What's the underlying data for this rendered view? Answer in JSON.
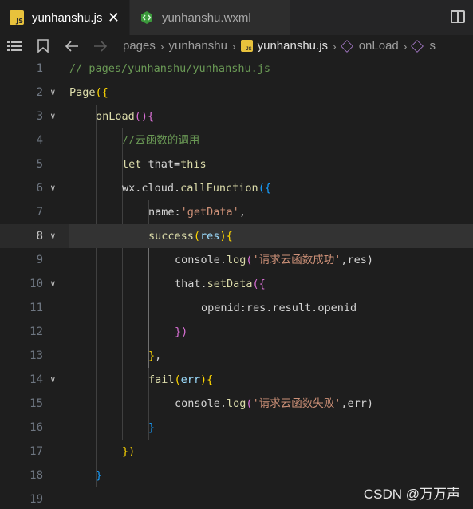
{
  "tabs": [
    {
      "label": "yunhanshu.js",
      "active": true,
      "icon": "js-file-icon",
      "close": "✕"
    },
    {
      "label": "yunhanshu.wxml",
      "active": false,
      "icon": "wxml-file-icon"
    }
  ],
  "breadcrumb": {
    "items": [
      "pages",
      "yunhanshu",
      "yunhanshu.js",
      "onLoad",
      "s"
    ]
  },
  "editor": {
    "current_line": 8,
    "lines": [
      {
        "n": "1"
      },
      {
        "n": "2"
      },
      {
        "n": "3"
      },
      {
        "n": "4"
      },
      {
        "n": "5"
      },
      {
        "n": "6"
      },
      {
        "n": "7"
      },
      {
        "n": "8"
      },
      {
        "n": "9"
      },
      {
        "n": "10"
      },
      {
        "n": "11"
      },
      {
        "n": "12"
      },
      {
        "n": "13"
      },
      {
        "n": "14"
      },
      {
        "n": "15"
      },
      {
        "n": "16"
      },
      {
        "n": "17"
      },
      {
        "n": "18"
      },
      {
        "n": "19"
      }
    ],
    "code": {
      "l1": "// pages/yunhanshu/yunhanshu.js",
      "l2_a": "Page",
      "l2_b": "({",
      "l3_a": "onLoad",
      "l3_b": "(){",
      "l4": "//云函数的调用",
      "l5_a": "let",
      "l5_b": " that=",
      "l5_c": "this",
      "l6_a": "wx.cloud.",
      "l6_b": "callFunction",
      "l6_c": "({",
      "l7_a": "name",
      "l7_b": ":",
      "l7_c": "'getData'",
      "l7_d": ",",
      "l8_a": "success",
      "l8_b": "(",
      "l8_c": "res",
      "l8_d": "){",
      "l9_a": "console.",
      "l9_b": "log",
      "l9_c": "(",
      "l9_d": "'请求云函数成功'",
      "l9_e": ",res)",
      "l10_a": "that.",
      "l10_b": "setData",
      "l10_c": "({",
      "l11_a": "openid",
      "l11_b": ":res.result.openid",
      "l12": "})",
      "l13_a": "}",
      "l13_b": ",",
      "l14_a": "fail",
      "l14_b": "(",
      "l14_c": "err",
      "l14_d": "){",
      "l15_a": "console.",
      "l15_b": "log",
      "l15_c": "(",
      "l15_d": "'请求云函数失败'",
      "l15_e": ",err)",
      "l16": "}",
      "l17": "})",
      "l18": "}"
    }
  },
  "watermark": "CSDN @万万声",
  "colors": {
    "background": "#1e1e1e",
    "comment": "#6a9955",
    "string": "#ce9178",
    "function": "#dcdcaa",
    "variable": "#9cdcfe"
  }
}
